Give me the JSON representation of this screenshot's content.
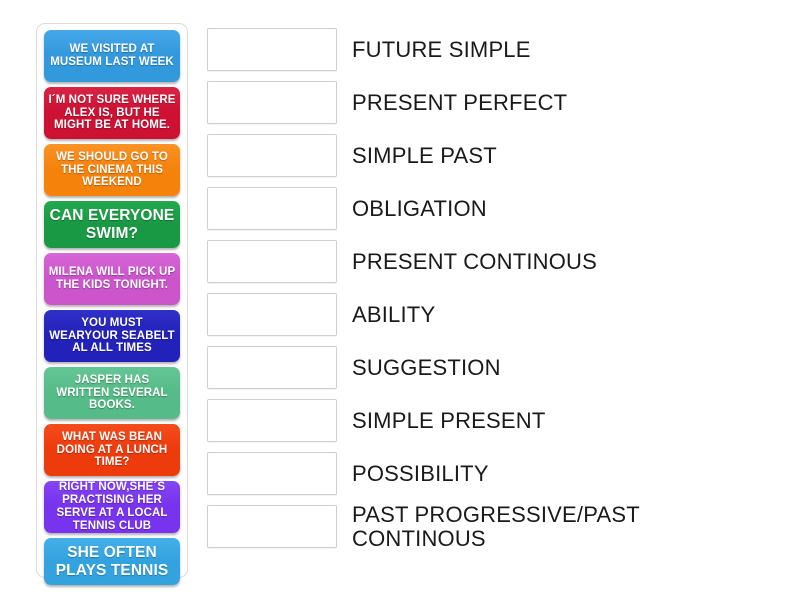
{
  "activity": {
    "type": "match-up-drag-and-drop",
    "tile_bank": {
      "name": "answer-tiles",
      "tiles": [
        {
          "text": "WE VISITED\nAT MUSEUM\nLAST WEEK",
          "color": "#3399dd",
          "color_top": "#45a7e8",
          "lines": 3
        },
        {
          "text": "I´M NOT SURE WHERE\nALEX IS, BUT HE\nMIGHT BE AT HOME.",
          "color": "#cc1133",
          "color_top": "#d92445",
          "lines": 3
        },
        {
          "text": "WE SHOULD GO\nTO THE CINEMA\nTHIS WEEKEND",
          "color": "#f5820b",
          "color_top": "#fa9326",
          "lines": 3
        },
        {
          "text": "CAN EVERYONE\nSWIM?",
          "color": "#1a9944",
          "color_top": "#22a850",
          "lines": 2
        },
        {
          "text": "MILENA WILL\nPICK UP THE\nKIDS TONIGHT.",
          "color": "#cc55cc",
          "color_top": "#d766d7",
          "lines": 3
        },
        {
          "text": "YOU MUST\nWEARYOUR SEABELT\nAL ALL TIMES",
          "color": "#2222bb",
          "color_top": "#3030c9",
          "lines": 3
        },
        {
          "text": "JASPER\nHAS WRITTEN\nSEVERAL BOOKS.",
          "color": "#55bb88",
          "color_top": "#63c795",
          "lines": 3
        },
        {
          "text": "WHAT WAS\nBEAN DOING AT\nA LUNCH TIME?",
          "color": "#ee3b0c",
          "color_top": "#f44c1d",
          "lines": 3
        },
        {
          "text": "RIGHT NOW,SHE´S\nPRACTISING HER SERVE\nAT A LOCAL TENNIS CLUB",
          "color": "#7733ee",
          "color_top": "#8544f5",
          "lines": 3
        },
        {
          "text": "SHE OFTEN\nPLAYS TENNIS",
          "color": "#33a3e0",
          "color_top": "#44b0ea",
          "lines": 2
        }
      ]
    },
    "answers": {
      "name": "answer-rows",
      "drop_placeholder": "",
      "rows": [
        {
          "label": "FUTURE SIMPLE",
          "value": ""
        },
        {
          "label": "PRESENT PERFECT",
          "value": ""
        },
        {
          "label": "SIMPLE PAST",
          "value": ""
        },
        {
          "label": "OBLIGATION",
          "value": ""
        },
        {
          "label": "PRESENT CONTINOUS",
          "value": ""
        },
        {
          "label": "ABILITY",
          "value": ""
        },
        {
          "label": "SUGGESTION",
          "value": ""
        },
        {
          "label": "SIMPLE PRESENT",
          "value": ""
        },
        {
          "label": "POSSIBILITY",
          "value": ""
        },
        {
          "label": "PAST PROGRESSIVE/PAST\nCONTINOUS",
          "value": ""
        }
      ]
    },
    "colors": {
      "page_background": "#ffffff",
      "bank_border": "#dcdcdc",
      "drop_zone_border": "#cfcfcf",
      "label_text": "#1a1a1a",
      "tile_text": "#ffffff"
    }
  }
}
